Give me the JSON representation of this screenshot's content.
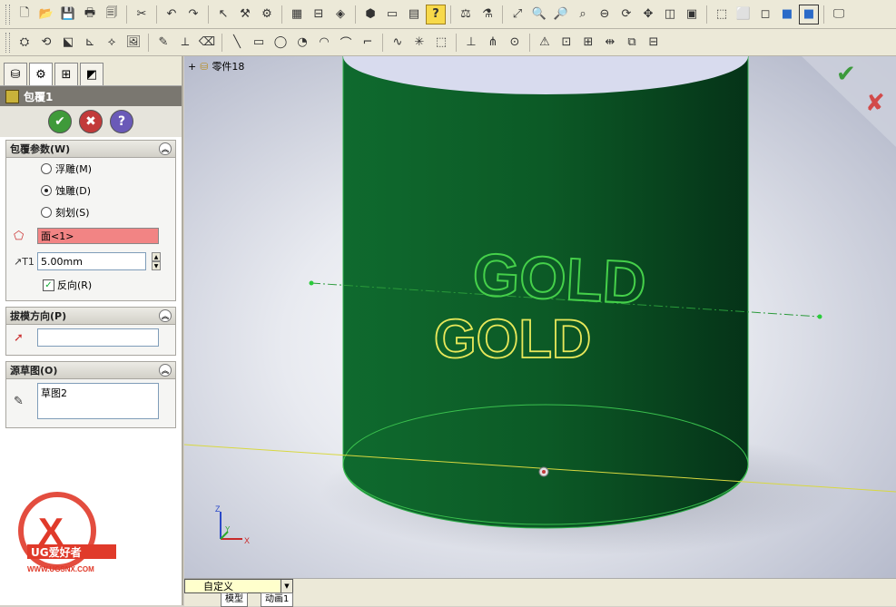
{
  "toolbar_top": {
    "icons": [
      "new-icon",
      "open-icon",
      "save-icon",
      "print-icon",
      "print-preview-icon",
      "undo-icon",
      "redo-icon",
      "select-icon",
      "rebuild-icon",
      "options-icon",
      "zoom-to-fit-icon",
      "zoom-area-icon",
      "zoom-in-out-icon",
      "rotate-icon",
      "pan-icon",
      "view-orientation-icon",
      "wireframe-icon",
      "hidden-lines-icon",
      "shaded-icon"
    ]
  },
  "panel": {
    "feature_title": "包覆1",
    "buttons": {
      "ok": "✔",
      "cancel": "✖",
      "help": "?"
    },
    "wrap_params": {
      "title": "包覆参数(W)",
      "options": [
        {
          "label": "浮雕(M)",
          "checked": false
        },
        {
          "label": "蚀雕(D)",
          "checked": true
        },
        {
          "label": "刻划(S)",
          "checked": false
        }
      ],
      "face_value": "面<1>",
      "depth_value": "5.00mm",
      "reverse_label": "反向(R)",
      "reverse_checked": true
    },
    "draft_direction": {
      "title": "拔模方向(P)",
      "value": ""
    },
    "source_sketch": {
      "title": "源草图(O)",
      "value": "草图2"
    }
  },
  "viewport": {
    "tree_node": "零件18",
    "text_emboss": "GOLD",
    "text_sketch": "GOLD",
    "axis_labels": {
      "z": "Z",
      "y": "Y",
      "x": "X"
    },
    "cylinder_color": "#0e5a2a",
    "accept_color": "#3c9a3c",
    "reject_color": "#d24a4a"
  },
  "bottom": {
    "view_select": "自定义",
    "tabs": [
      "模型",
      "动画1"
    ]
  },
  "watermark": {
    "brand": "UG爱好者",
    "url": "WWW.UGSNX.COM"
  }
}
